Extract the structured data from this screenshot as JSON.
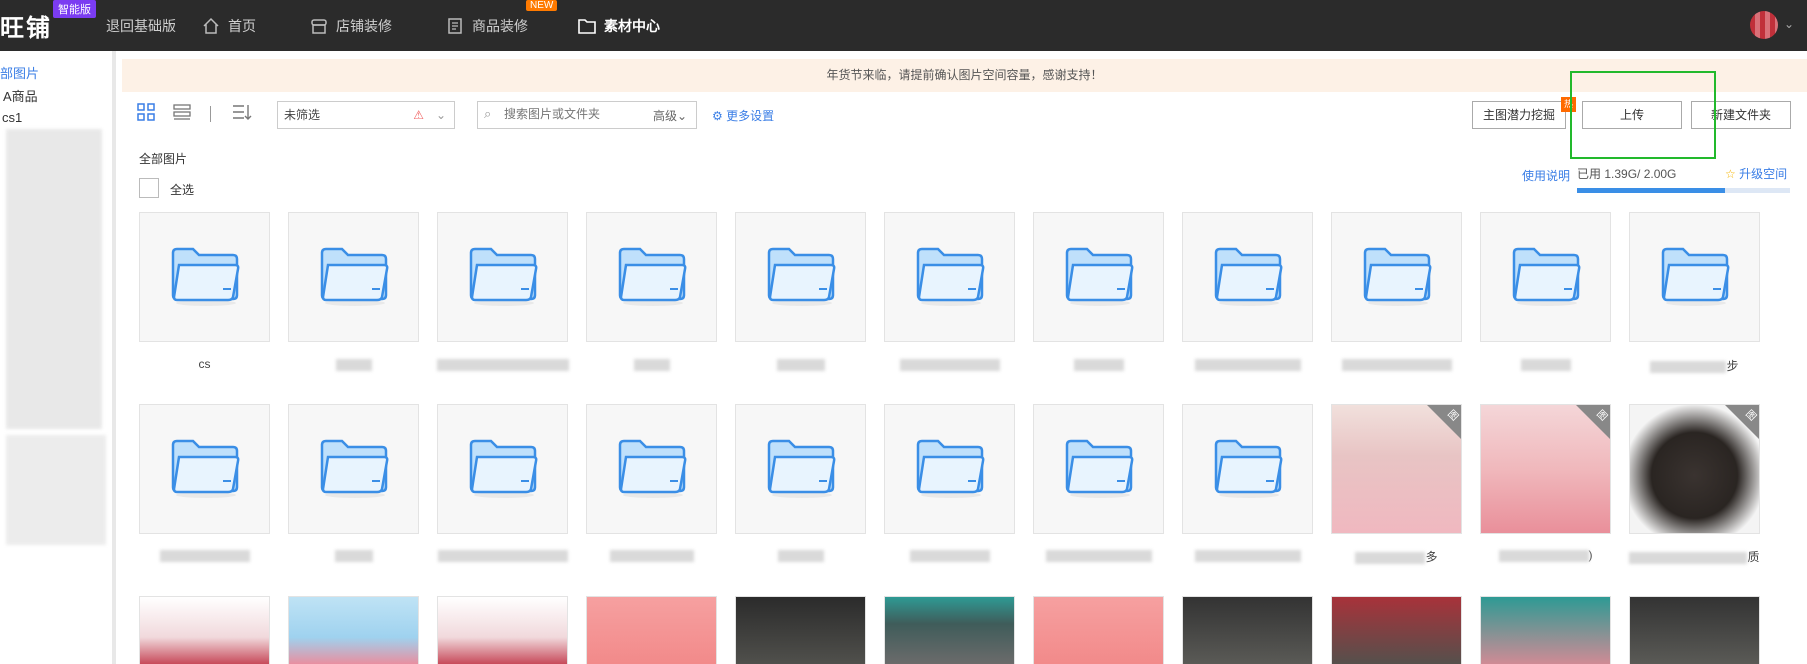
{
  "topbar": {
    "logo": "旺铺",
    "badge": "智能版",
    "back_basic": "退回基础版",
    "nav": [
      {
        "label": "首页",
        "icon": "home-icon"
      },
      {
        "label": "店铺装修",
        "icon": "shop-decor-icon"
      },
      {
        "label": "商品装修",
        "icon": "product-decor-icon",
        "tag": "NEW"
      },
      {
        "label": "素材中心",
        "icon": "folder-icon",
        "active": true
      }
    ]
  },
  "sidebar": {
    "items": [
      {
        "label": "部图片"
      },
      {
        "label": "A商品"
      },
      {
        "label": "cs1"
      }
    ]
  },
  "notice": "年货节来临，请提前确认图片空间容量，感谢支持！",
  "toolbar": {
    "filter_value": "未筛选",
    "search_placeholder": "搜索图片或文件夹",
    "advanced": "高级",
    "more_settings": "更多设置",
    "btn_mining": "主图潜力挖掘",
    "btn_upload": "上传",
    "btn_new_folder": "新建文件夹",
    "hot_tag": "热"
  },
  "content": {
    "breadcrumb": "全部图片",
    "select_all": "全选",
    "help": "使用说明",
    "usage_label": "已用 1.39G/ 2.00G",
    "usage_fraction": 0.695,
    "upgrade": "升级空间"
  },
  "tiles_row1": [
    {
      "label": "cs"
    },
    {
      "label": ""
    },
    {
      "label": ""
    },
    {
      "label": ""
    },
    {
      "label": ""
    },
    {
      "label": ""
    },
    {
      "label": ""
    },
    {
      "label": ""
    },
    {
      "label": ""
    },
    {
      "label": ""
    },
    {
      "label": "步"
    }
  ],
  "tiles_row2_labels": [
    "",
    "",
    "",
    "",
    "",
    "",
    "",
    "",
    "多",
    ")",
    "质"
  ],
  "colors": {
    "accent": "#3a7ee6",
    "highlight": "#22b92c",
    "topbar": "#2b2b2b"
  }
}
